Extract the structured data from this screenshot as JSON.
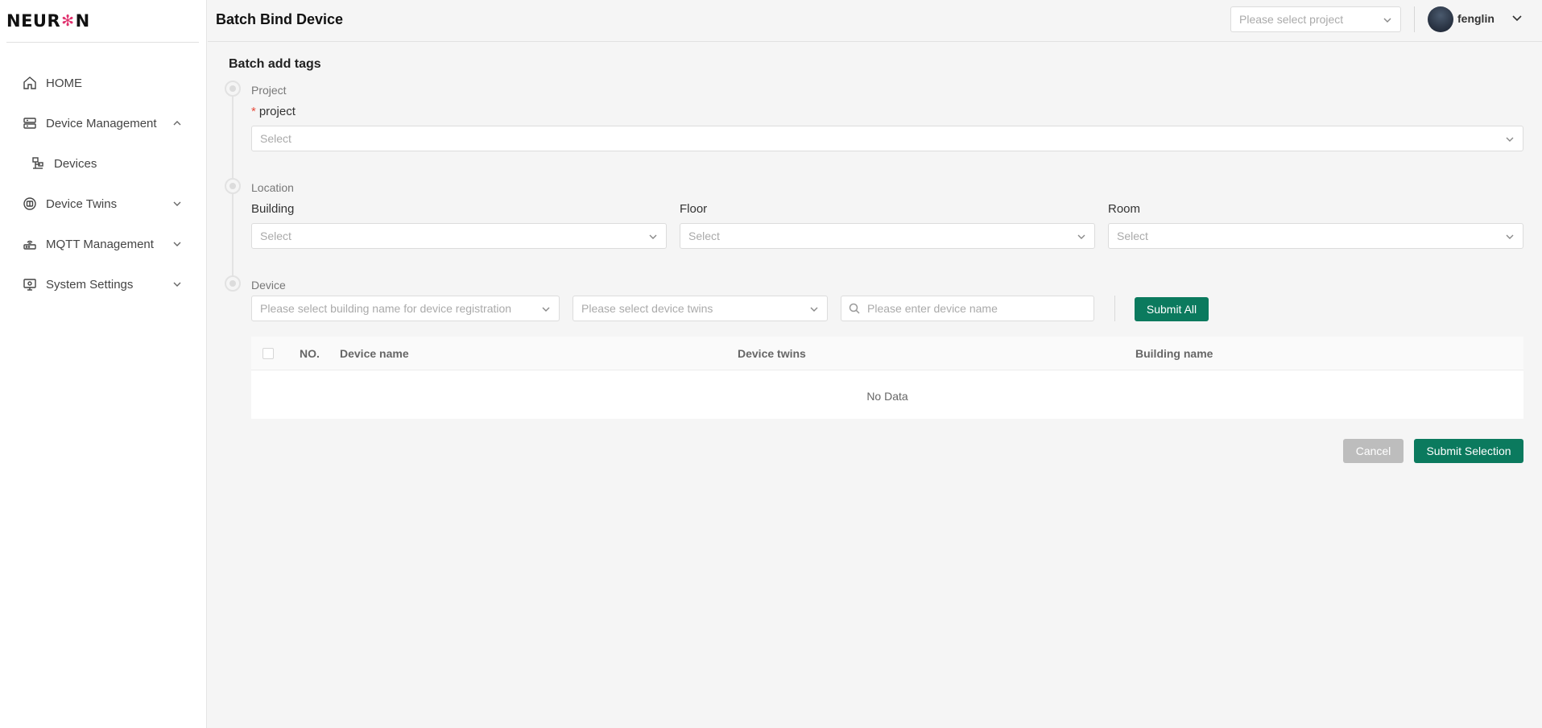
{
  "brand": {
    "name_left": "NEUR",
    "name_right": "N"
  },
  "sidebar": {
    "items": [
      {
        "label": "HOME",
        "icon": "home-icon",
        "chevron": ""
      },
      {
        "label": "Device Management",
        "icon": "server-icon",
        "chevron": "up"
      },
      {
        "label": "Devices",
        "icon": "devices-icon",
        "chevron": ""
      },
      {
        "label": "Device Twins",
        "icon": "twins-icon",
        "chevron": "down"
      },
      {
        "label": "MQTT Management",
        "icon": "router-icon",
        "chevron": "down"
      },
      {
        "label": "System Settings",
        "icon": "monitor-icon",
        "chevron": "down"
      }
    ]
  },
  "header": {
    "title": "Batch Bind Device",
    "project_placeholder": "Please select project",
    "username": "fenglin"
  },
  "form": {
    "section_title": "Batch add tags",
    "steps": {
      "project": {
        "label": "Project",
        "field_label": "project",
        "placeholder": "Select"
      },
      "location": {
        "label": "Location",
        "building_label": "Building",
        "floor_label": "Floor",
        "room_label": "Room",
        "placeholder": "Select"
      },
      "device": {
        "label": "Device",
        "building_placeholder": "Please select building name for device registration",
        "twins_placeholder": "Please select device twins",
        "search_placeholder": "Please enter device name",
        "submit_all": "Submit All"
      }
    }
  },
  "table": {
    "columns": [
      "NO.",
      "Device name",
      "Device twins",
      "Building name"
    ],
    "empty_text": "No Data"
  },
  "actions": {
    "cancel": "Cancel",
    "submit_selection": "Submit Selection"
  },
  "colors": {
    "primary": "#0b7a5e",
    "cancel": "#bdbdbd",
    "required": "#e74c3c"
  }
}
